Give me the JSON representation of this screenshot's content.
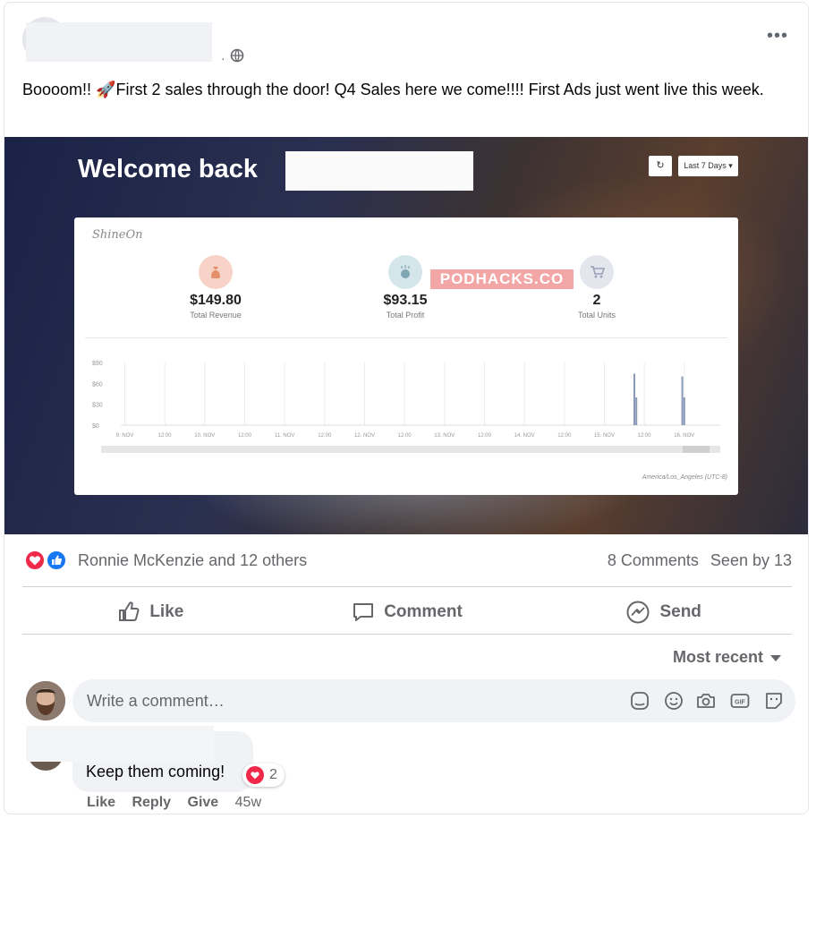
{
  "post": {
    "privacy_icon": "globe-icon",
    "text": "Boooom!! 🚀First 2 sales through the door! Q4 Sales here we come!!!! First Ads just went live this week."
  },
  "screenshot": {
    "welcome": "Welcome back",
    "range_label": "Last 7 Days ▾",
    "refresh_icon": "refresh-icon",
    "logo": "ShineOn",
    "watermark": "PODHACKS.CO",
    "stats": [
      {
        "value": "$149.80",
        "label": "Total Revenue",
        "icon": "money-bag-icon",
        "color": "#f6d3c6"
      },
      {
        "value": "$93.15",
        "label": "Total Profit",
        "icon": "coin-icon",
        "color": "#d4e6ea"
      },
      {
        "value": "2",
        "label": "Total Units",
        "icon": "cart-icon",
        "color": "#e4e6ee"
      }
    ],
    "timezone": "America/Los_Angeles (UTC-8)",
    "chart_data": {
      "type": "bar",
      "yticks": [
        "$90",
        "$60",
        "$30",
        "$0"
      ],
      "ylim": [
        0,
        90
      ],
      "xticks": [
        "9. NOV",
        "12:00",
        "10. NOV",
        "12:00",
        "11. NOV",
        "12:00",
        "12. NOV",
        "12:00",
        "13. NOV",
        "12:00",
        "14. NOV",
        "12:00",
        "15. NOV",
        "12:00",
        "16. NOV"
      ],
      "bars": [
        {
          "x": 12.75,
          "value": 74
        },
        {
          "x": 12.8,
          "value": 40
        },
        {
          "x": 13.95,
          "value": 70
        },
        {
          "x": 14.0,
          "value": 40
        }
      ],
      "bar_color": "#8a98b8"
    }
  },
  "reactions": {
    "names": "Ronnie McKenzie and 12 others",
    "comments": "8 Comments",
    "seen": "Seen by 13",
    "love_color": "#f02849",
    "like_color": "#1877f2"
  },
  "actions": {
    "like": "Like",
    "comment": "Comment",
    "send": "Send"
  },
  "sort": {
    "label": "Most recent"
  },
  "composer": {
    "placeholder": "Write a comment…"
  },
  "comment": {
    "text": "Keep them coming!",
    "reaction_count": "2",
    "like": "Like",
    "reply": "Reply",
    "give": "Give",
    "time": "45w"
  }
}
